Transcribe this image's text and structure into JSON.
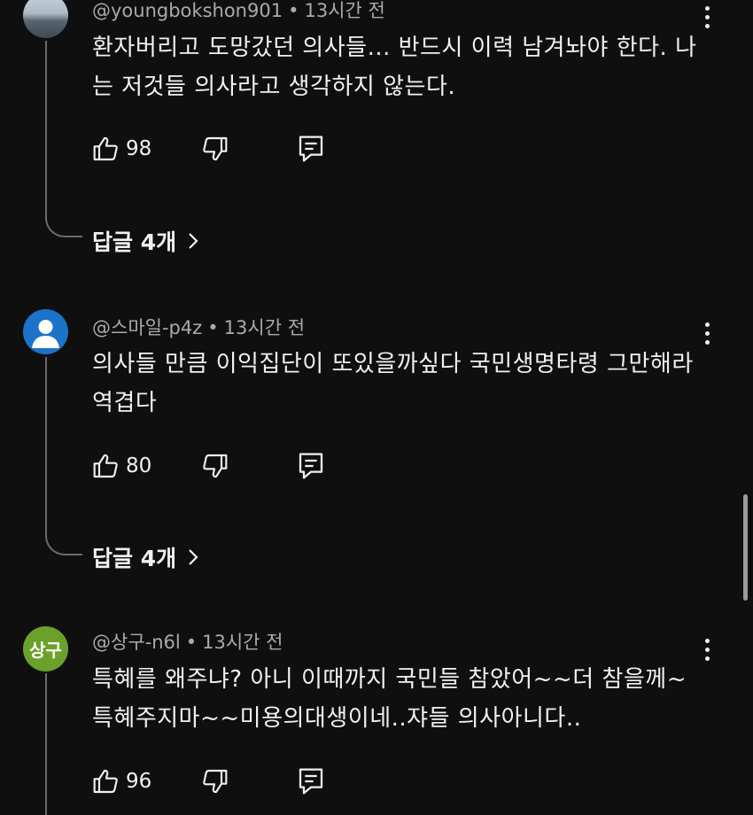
{
  "comments": [
    {
      "author": "@youngbokshon901",
      "time": "13시간 전",
      "text": "환자버리고 도망갔던 의사들... 반드시 이력 남겨놔야 한다. 나는 저것들 의사라고 생각하지 않는다.",
      "likes": "98",
      "replies_label": "답글 4개",
      "avatar_style": "photo-sea"
    },
    {
      "author": "@스마일-p4z",
      "time": "13시간 전",
      "text": "의사들 만큼 이익집단이 또있을까싶다 국민생명타령 그만해라 역겹다",
      "likes": "80",
      "replies_label": "답글 4개",
      "avatar_style": "default-person"
    },
    {
      "author": "@상구-n6l",
      "time": "13시간 전",
      "text": "특혜를 왜주냐? 아니 이때까지 국민들 참았어~~더 참을께~ 특혜주지마~~미용의대생이네..쟈들 의사아니다..",
      "likes": "96",
      "avatar_text": "상구",
      "avatar_style": "initials-green"
    }
  ],
  "header_separator": "•",
  "icons": {
    "like": "thumbs-up-icon",
    "dislike": "thumbs-down-icon",
    "reply": "reply-comment-icon",
    "more": "more-vert-icon",
    "chevron": "chevron-right-icon"
  },
  "colors": {
    "background": "#0f0f0f",
    "text": "#f1f1f1",
    "meta_text": "#aaaaaa",
    "thread_line": "#6b6b6b"
  }
}
